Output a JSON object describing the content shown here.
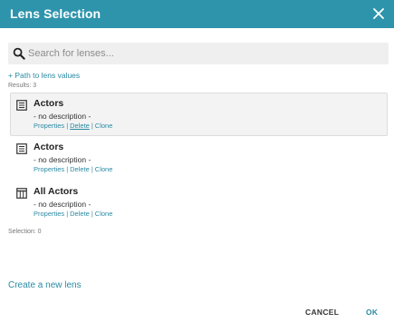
{
  "dialog": {
    "title": "Lens Selection"
  },
  "search": {
    "placeholder": "Search for lenses...",
    "value": ""
  },
  "path_link": "+ Path to lens values",
  "results_text": "Results: 3",
  "lenses": [
    {
      "name": "Actors",
      "description": "- no description -",
      "icon": "document-list-icon",
      "selected": true,
      "actions": {
        "properties": "Properties",
        "delete": "Delete",
        "clone": "Clone"
      }
    },
    {
      "name": "Actors",
      "description": "- no description -",
      "icon": "document-list-icon",
      "selected": false,
      "actions": {
        "properties": "Properties",
        "delete": "Delete",
        "clone": "Clone"
      }
    },
    {
      "name": "All Actors",
      "description": "- no description -",
      "icon": "table-icon",
      "selected": false,
      "actions": {
        "properties": "Properties",
        "delete": "Delete",
        "clone": "Clone"
      }
    }
  ],
  "action_separator": "|",
  "selection_text": "Selection: 0",
  "create_link": "Create a new lens",
  "buttons": {
    "cancel": "CANCEL",
    "ok": "OK"
  },
  "colors": {
    "header": "#2e94ac",
    "link": "#2a8aa4",
    "selected_bg": "#f3f3f3"
  }
}
